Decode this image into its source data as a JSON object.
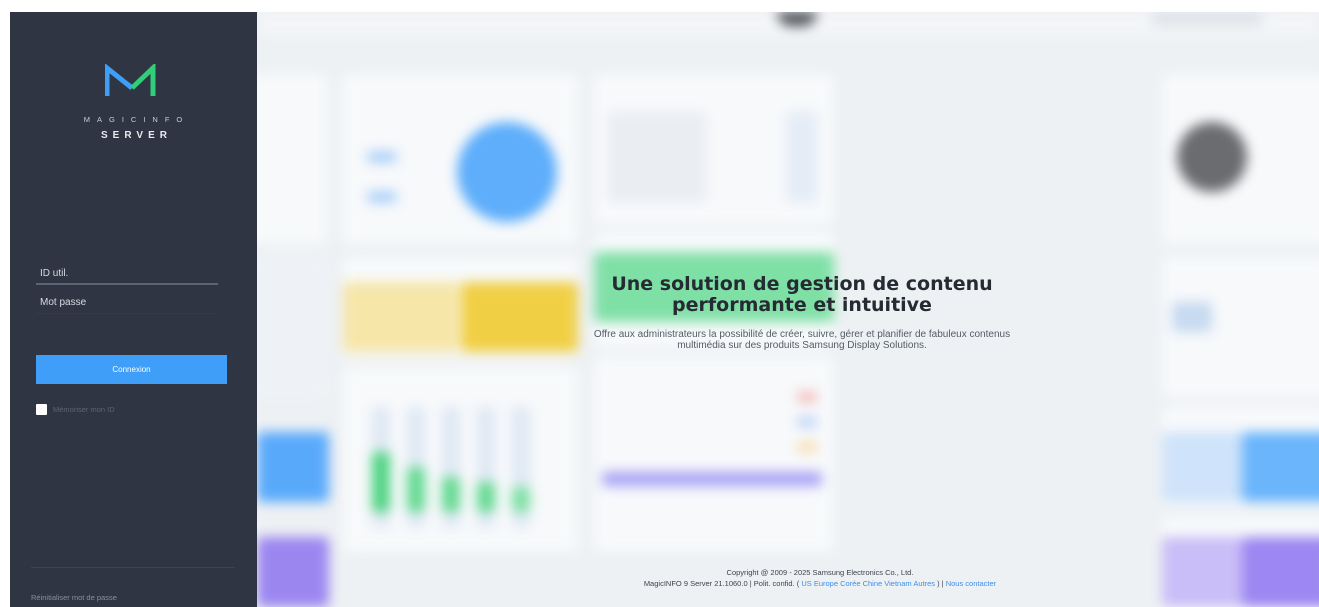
{
  "brand": {
    "line1": "MAGICINFO",
    "line2": "SERVER",
    "colors": {
      "logo_blue": "#3e9ef8",
      "logo_green": "#2fcf7a"
    }
  },
  "login": {
    "userid_placeholder": "ID util.",
    "password_placeholder": "Mot passe",
    "submit_label": "Connexion",
    "remember_label": "Mémoriser mon ID",
    "reset_password_label": "Réinitialiser mot de passe"
  },
  "hero": {
    "title": "Une solution de gestion de contenu performante et intuitive",
    "subtitle": "Offre aux administrateurs la possibilité de créer, suivre, gérer et planifier de fabuleux contenus multimédia sur des produits Samsung Display Solutions."
  },
  "footer": {
    "copyright": "Copyright @ 2009 - 2025 Samsung Electronics Co., Ltd.",
    "version": "MagicINFO 9 Server 21.1060.0",
    "privacy_label": "Polit. confid.",
    "regions": "US Europe Corée Chine Vietnam Autres",
    "contact_label": "Nous contacter"
  },
  "colors": {
    "panel": "#2f3542",
    "accent": "#3e9ef8"
  }
}
